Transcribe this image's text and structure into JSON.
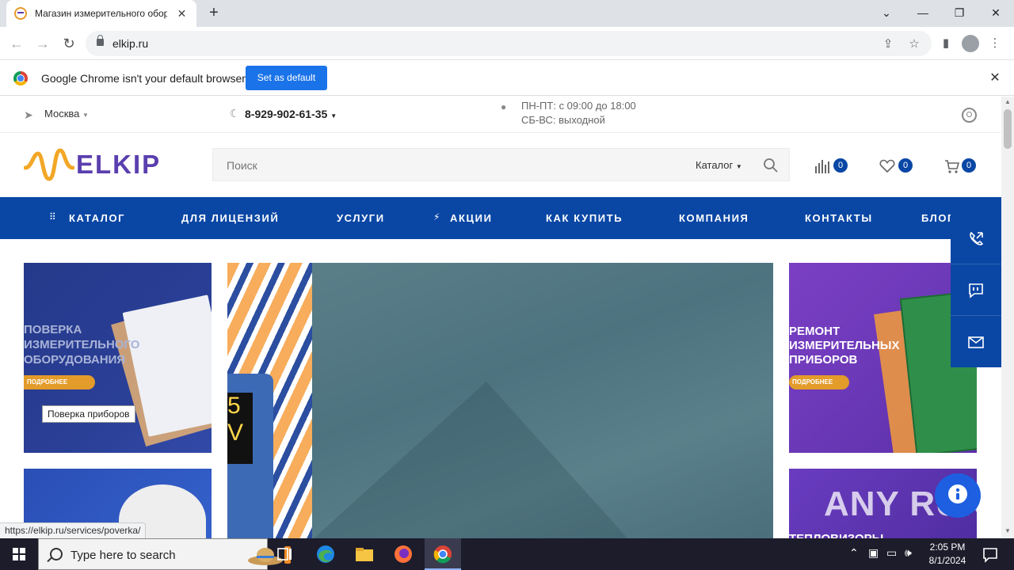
{
  "browser": {
    "tab_title": "Магазин измерительного обор",
    "url": "elkip.ru",
    "infobar_text": "Google Chrome isn't your default browser",
    "set_default_label": "Set as default"
  },
  "site": {
    "city": "Москва",
    "phone": "8-929-902-61-35",
    "hours_weekdays": "ПН-ПТ: с 09:00 до 18:00",
    "hours_weekend": "СБ-ВС: выходной",
    "logo_text": "ELKIP",
    "search_placeholder": "Поиск",
    "search_category": "Каталог",
    "compare_count": "0",
    "favorites_count": "0",
    "cart_count": "0",
    "nav": [
      {
        "label": "КАТАЛОГ"
      },
      {
        "label": "ДЛЯ ЛИЦЕНЗИЙ"
      },
      {
        "label": "УСЛУГИ"
      },
      {
        "label": "АКЦИИ"
      },
      {
        "label": "КАК КУПИТЬ"
      },
      {
        "label": "КОМПАНИЯ"
      },
      {
        "label": "КОНТАКТЫ"
      },
      {
        "label": "БЛОГ"
      }
    ],
    "banners": {
      "poverka_title": "ПОВЕРКА ИЗМЕРИТЕЛЬНОГО ОБОРУДОВАНИЯ",
      "poverka_more": "ПОДРОБНЕЕ",
      "remont_title": "РЕМОНТ ИЗМЕРИТЕЛЬНЫХ ПРИБОРОВ",
      "remont_more": "ПОДРОБНЕЕ",
      "tv_title": "ТЕПЛОВИЗОРЫ",
      "device_reading": "5\nV"
    },
    "tooltip": "Поверка приборов"
  },
  "status_link": "https://elkip.ru/services/poverka/",
  "watermark": "ANY RUN",
  "taskbar": {
    "search_placeholder": "Type here to search",
    "time": "2:05 PM",
    "date": "8/1/2024"
  },
  "colors": {
    "brand_blue": "#0a47a5",
    "brand_purple": "#5a3fae",
    "brand_orange": "#e89a2c",
    "chrome_blue": "#1a73e8"
  }
}
